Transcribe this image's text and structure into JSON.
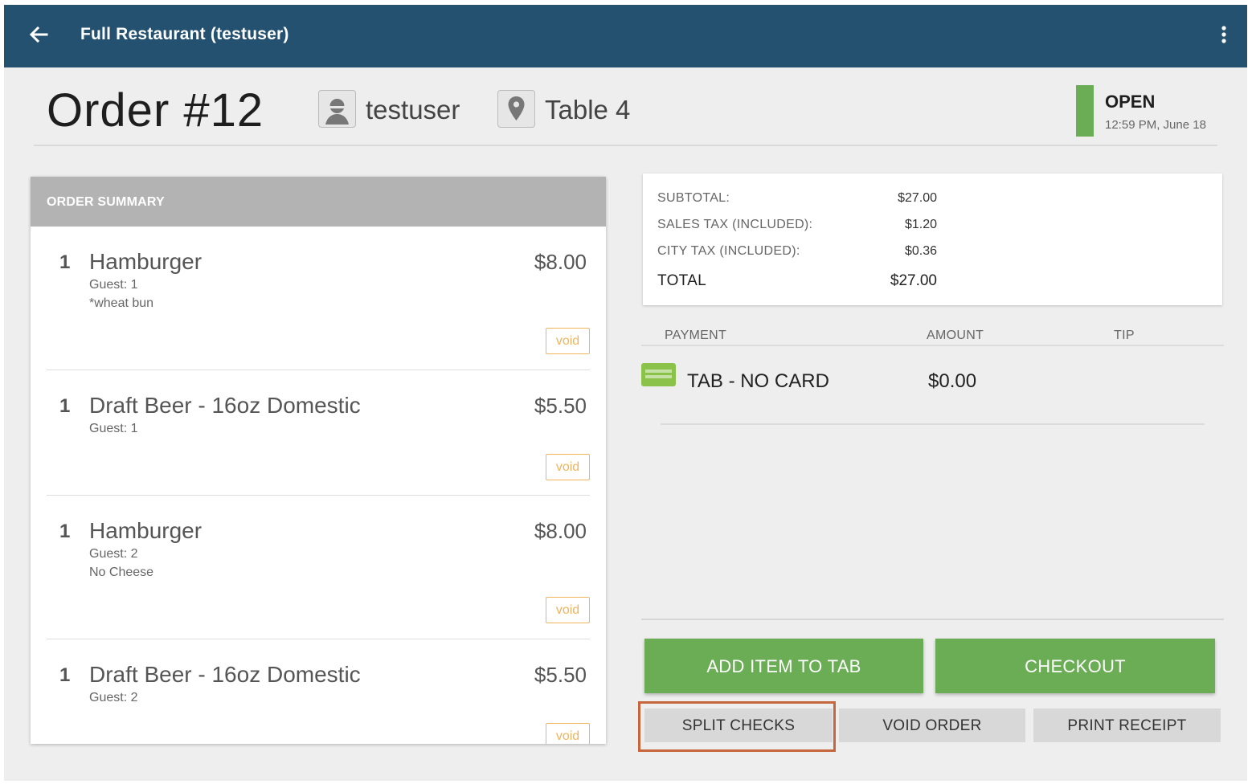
{
  "appbar": {
    "title": "Full Restaurant (testuser)",
    "back_icon": "arrow-left-icon",
    "menu_icon": "more-vertical-icon",
    "color": "#24516f"
  },
  "order": {
    "title": "Order #12",
    "user": "testuser",
    "table": "Table 4",
    "status": "OPEN",
    "status_time": "12:59 PM, June 18",
    "status_color": "#6aad55"
  },
  "summary": {
    "header": "ORDER SUMMARY",
    "void_label": "void",
    "items": [
      {
        "qty": "1",
        "name": "Hamburger",
        "price": "$8.00",
        "guest": "Guest: 1",
        "note": "*wheat bun"
      },
      {
        "qty": "1",
        "name": "Draft Beer - 16oz Domestic",
        "price": "$5.50",
        "guest": "Guest: 1",
        "note": ""
      },
      {
        "qty": "1",
        "name": "Hamburger",
        "price": "$8.00",
        "guest": "Guest: 2",
        "note": "No Cheese"
      },
      {
        "qty": "1",
        "name": "Draft Beer - 16oz Domestic",
        "price": "$5.50",
        "guest": "Guest: 2",
        "note": ""
      }
    ]
  },
  "totals": {
    "subtotal_label": "SUBTOTAL:",
    "subtotal": "$27.00",
    "sales_tax_label": "SALES TAX (INCLUDED):",
    "sales_tax": "$1.20",
    "city_tax_label": "CITY TAX (INCLUDED):",
    "city_tax": "$0.36",
    "total_label": "TOTAL",
    "total": "$27.00"
  },
  "payments": {
    "col_payment": "PAYMENT",
    "col_amount": "AMOUNT",
    "col_tip": "TIP",
    "rows": [
      {
        "icon": "credit-card-icon",
        "name": "TAB - NO CARD",
        "amount": "$0.00"
      }
    ]
  },
  "actions": {
    "add_item": "ADD ITEM TO TAB",
    "checkout": "CHECKOUT",
    "split_checks": "SPLIT CHECKS",
    "void_order": "VOID ORDER",
    "print_receipt": "PRINT RECEIPT",
    "accent_green": "#6aad55",
    "highlight_color": "#c7653d"
  }
}
